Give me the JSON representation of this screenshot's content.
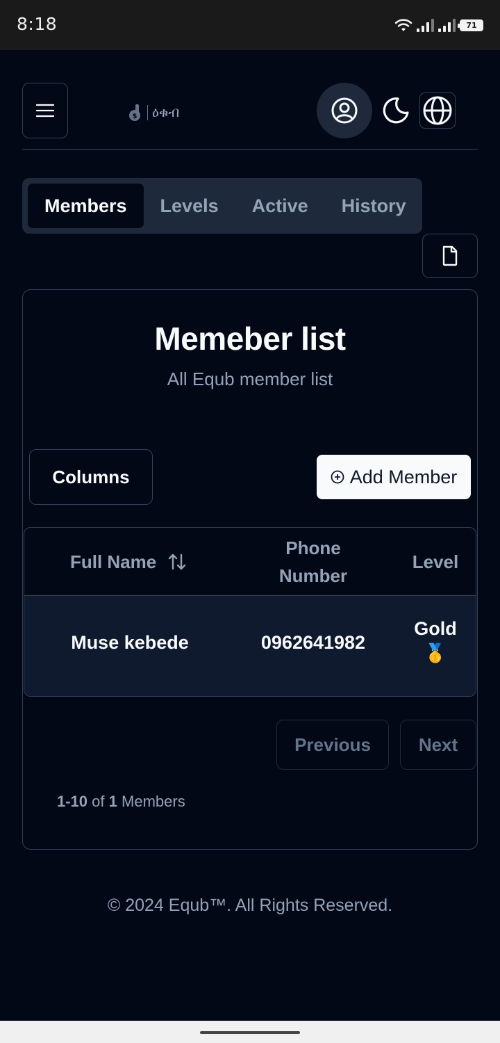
{
  "status_bar": {
    "time": "8:18",
    "battery": "71"
  },
  "header": {
    "logo_text": "ዕቁብ"
  },
  "tabs": [
    {
      "label": "Members",
      "active": true
    },
    {
      "label": "Levels",
      "active": false
    },
    {
      "label": "Active",
      "active": false
    },
    {
      "label": "History",
      "active": false
    }
  ],
  "card": {
    "title": "Memeber list",
    "subtitle": "All Equb member list",
    "columns_label": "Columns",
    "add_member_label": "Add Member"
  },
  "table": {
    "headers": {
      "full_name": "Full Name",
      "phone_line1": "Phone",
      "phone_line2": "Number",
      "level": "Level"
    },
    "rows": [
      {
        "full_name": "Muse kebede",
        "phone": "0962641982",
        "level": "Gold",
        "level_badge": "🥇"
      }
    ]
  },
  "pagination": {
    "previous_label": "Previous",
    "next_label": "Next",
    "range": "1-10",
    "of_text": "of",
    "total": "1",
    "unit": "Members"
  },
  "footer": {
    "text": "© 2024 Equb™. All Rights Reserved."
  },
  "colors": {
    "background": "#030817",
    "muted": "#94a3b8",
    "border": "#334155",
    "surface": "#1e293b"
  }
}
